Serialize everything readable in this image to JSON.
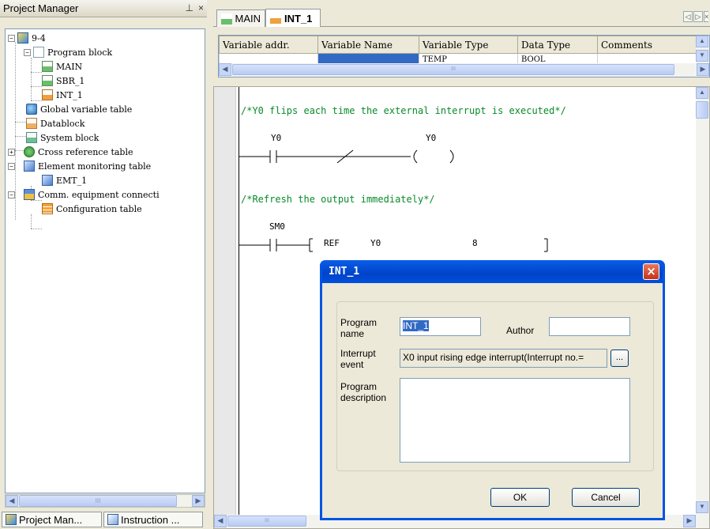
{
  "project_manager": {
    "title": "Project Manager",
    "pin_glyph": "⊥",
    "close_glyph": "×",
    "tree": [
      {
        "label": "9-4",
        "icon": "project-icon",
        "level": 0,
        "expander": "−"
      },
      {
        "label": "Program block",
        "icon": "program-block-icon",
        "level": 1,
        "expander": "−"
      },
      {
        "label": "MAIN",
        "icon": "main-program-icon",
        "level": 2
      },
      {
        "label": "SBR_1",
        "icon": "subroutine-icon",
        "level": 2
      },
      {
        "label": "INT_1",
        "icon": "interrupt-icon",
        "level": 2
      },
      {
        "label": "Global variable table",
        "icon": "global-variable-icon",
        "level": 1
      },
      {
        "label": "Datablock",
        "icon": "datablock-icon",
        "level": 1
      },
      {
        "label": "System block",
        "icon": "system-block-icon",
        "level": 1
      },
      {
        "label": "Cross reference table",
        "icon": "cross-reference-icon",
        "level": 1,
        "expander": "+"
      },
      {
        "label": "Element monitoring table",
        "icon": "monitoring-table-icon",
        "level": 1,
        "expander": "−"
      },
      {
        "label": "EMT_1",
        "icon": "emt-icon",
        "level": 2
      },
      {
        "label": "Comm. equipment connecti",
        "icon": "comm-equipment-icon",
        "level": 1,
        "expander": "−"
      },
      {
        "label": "Configuration table",
        "icon": "configuration-table-icon",
        "level": 2
      }
    ],
    "bottom_tabs": [
      "Project Man...",
      "Instruction ..."
    ]
  },
  "editor_tabs": [
    "MAIN",
    "INT_1"
  ],
  "variable_table": {
    "columns": [
      "Variable addr.",
      "Variable Name",
      "Variable Type",
      "Data Type",
      "Comments"
    ],
    "row": [
      "",
      "",
      "TEMP",
      "BOOL",
      ""
    ]
  },
  "ladder": {
    "comment1": "/*Y0 flips each time the external interrupt is executed*/",
    "contact1": "Y0",
    "coil1": "Y0",
    "comment2": "/*Refresh the output immediately*/",
    "contact2": "SM0",
    "instr_name": "REF",
    "instr_op1": "Y0",
    "instr_op2": "8"
  },
  "dialog": {
    "title": "INT_1",
    "program_name_label": "Program name",
    "program_name_value": "INT_1",
    "author_label": "Author",
    "author_value": "",
    "interrupt_event_label": "Interrupt event",
    "interrupt_event_value": "X0 input rising edge interrupt(Interrupt no.=",
    "browse_label": "...",
    "description_label": "Program description",
    "description_value": "",
    "ok_label": "OK",
    "cancel_label": "Cancel"
  },
  "colors": {
    "xp_blue": "#0054e3",
    "selection": "#316ac5",
    "comment_green": "#0a8a2a"
  }
}
